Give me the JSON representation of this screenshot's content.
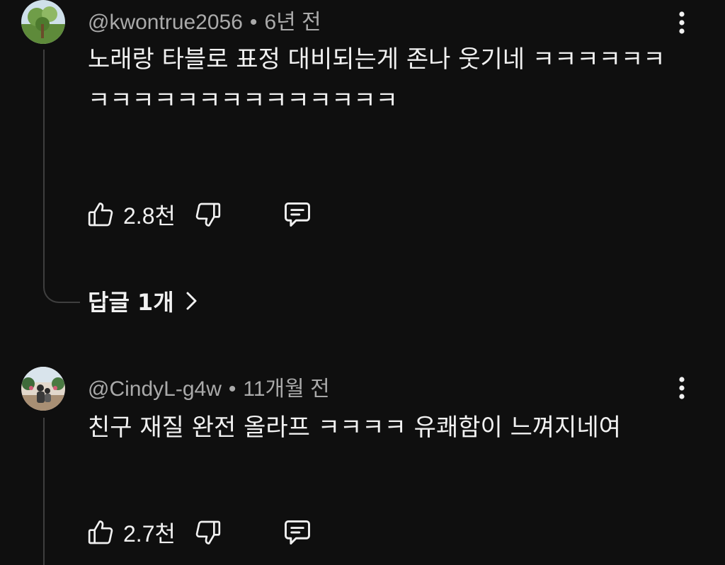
{
  "comments": [
    {
      "author": "@kwontrue2056",
      "time": "6년 전",
      "text": "노래랑 타블로 표정 대비되는게 존나 웃기네 ㅋㅋㅋㅋㅋㅋㅋㅋㅋㅋㅋㅋㅋㅋㅋㅋㅋㅋㅋㅋ",
      "likes": "2.8천",
      "replies_label": "답글 1개"
    },
    {
      "author": "@CindyL-g4w",
      "time": "11개월 전",
      "text": "친구 재질 완전 올라프 ㅋㅋㅋㅋ 유쾌함이 느껴지네여",
      "likes": "2.7천"
    }
  ],
  "separator": "•",
  "icons": {
    "like": "thumbs-up-icon",
    "dislike": "thumbs-down-icon",
    "reply": "comment-icon",
    "more": "vertical-ellipsis-icon",
    "replies_expand": "chevron-right-icon"
  },
  "colors": {
    "background": "#0f0f0f",
    "text": "#f1f1f1",
    "secondary": "#aaaaaa",
    "thread_line": "#3f3f3f"
  }
}
